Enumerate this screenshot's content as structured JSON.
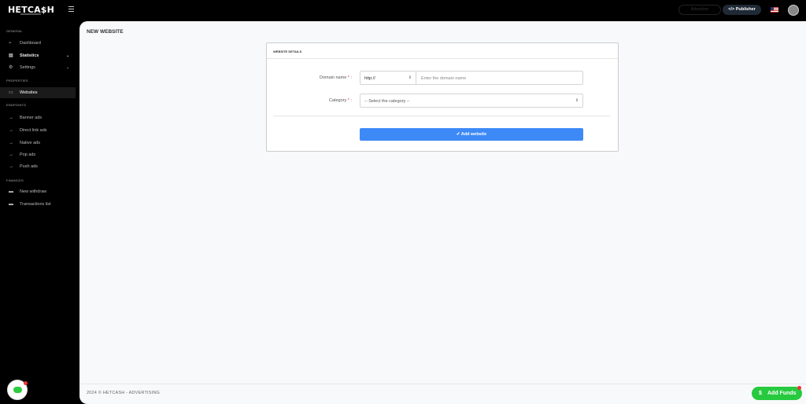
{
  "brand": {
    "name": "HETCA$H"
  },
  "header": {
    "advertiser_label": "Advertiser",
    "publisher_label": "Publisher",
    "publisher_icon": "code-icon",
    "flag": "us-flag-icon",
    "accent": "#1f2a36"
  },
  "sidebar": {
    "general_title": "GENERAL",
    "dashboard": "Dashboard",
    "statistics": "Statistics",
    "settings": "Settings",
    "properties_title": "PROPERTIES",
    "websites": "Websites",
    "endpoints_title": "ENDPOINTS",
    "endpoints": [
      "Banner ads",
      "Direct link ads",
      "Native ads",
      "Pop ads",
      "Push ads"
    ],
    "finances_title": "FINANCES",
    "new_withdraw": "New withdraw",
    "transactions": "Transactions list"
  },
  "page": {
    "title": "NEW WEBSITE",
    "card_title": "WEBSITE DETAILS",
    "domain_label": "Domain name",
    "required_mark": "*",
    "protocol_value": "http://",
    "domain_placeholder": "Enter the domain name",
    "category_label": "Category",
    "category_value": "-- Select the category --",
    "submit_label": "Add website",
    "submit_color": "#3d8af7"
  },
  "footer": {
    "text": "2024 © HETCASH - ADVERTISING"
  },
  "funds": {
    "label": "Add Funds",
    "color": "#27c93f"
  }
}
